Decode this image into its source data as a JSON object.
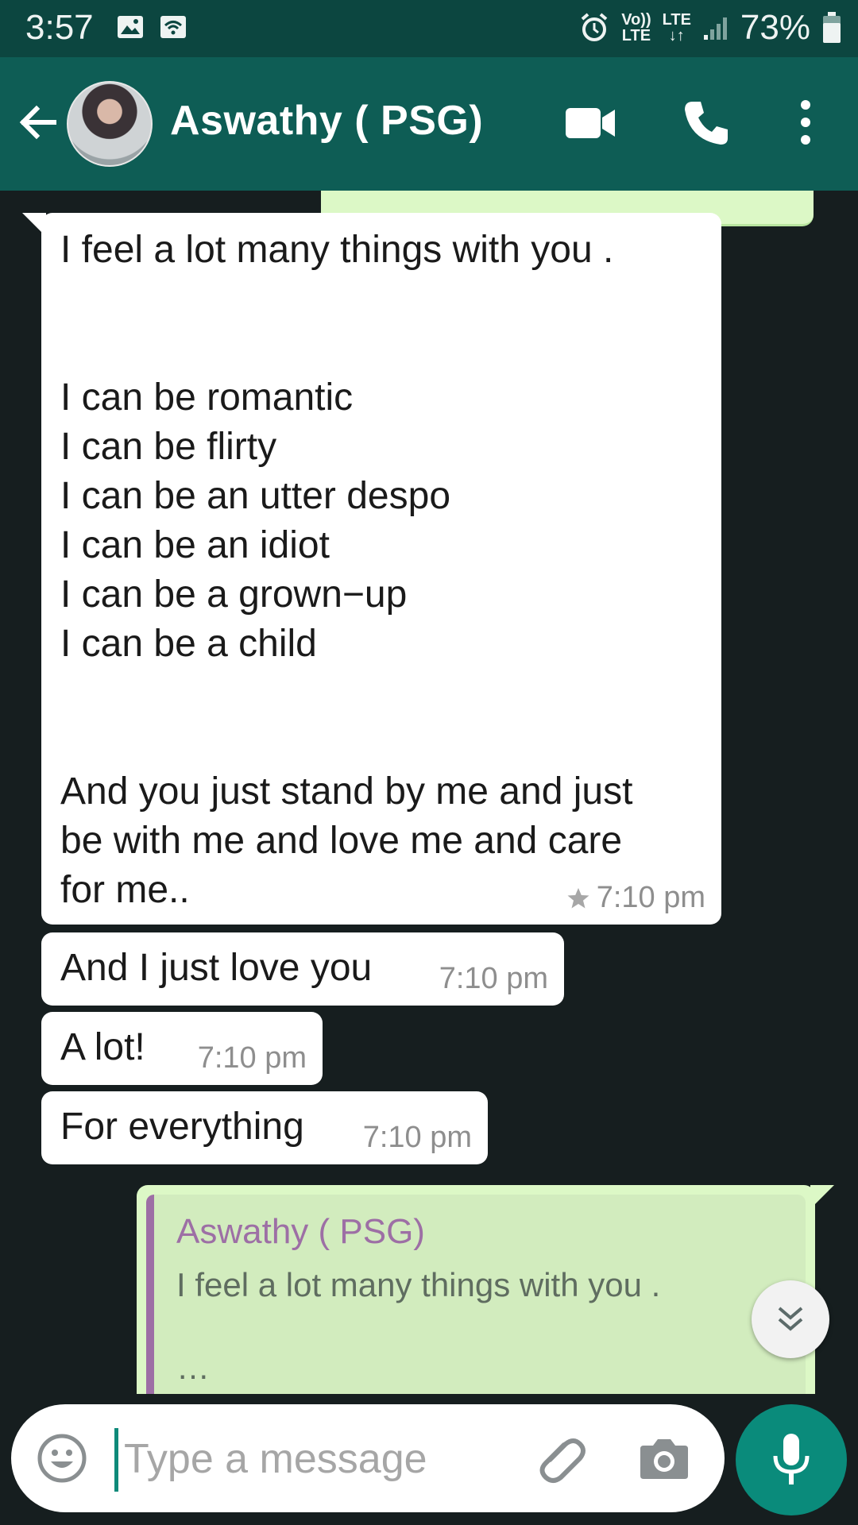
{
  "status_bar": {
    "time": "3:57",
    "volte_label_1": "Vo))",
    "volte_label_2": "LTE",
    "lte_label_1": "LTE",
    "lte_label_2": "↓↑",
    "battery": "73%"
  },
  "header": {
    "contact_name": "Aswathy ( PSG)"
  },
  "messages": [
    {
      "text": "I feel a lot many things with you .\n\n\nI can be romantic\nI can be flirty\nI can be an utter despo\nI can be an idiot\nI can be a grown−up\nI can be a child\n\n\nAnd you just stand by me and just\nbe with me and love me and care\nfor me..",
      "time": "7:10 pm",
      "starred": true
    },
    {
      "text": "And I just love you",
      "time": "7:10 pm"
    },
    {
      "text": "A lot!",
      "time": "7:10 pm"
    },
    {
      "text": "For everything",
      "time": "7:10 pm"
    }
  ],
  "outgoing_reply": {
    "quoted_author": "Aswathy ( PSG)",
    "quoted_text": "I feel a lot many things with you .\n\n…"
  },
  "composer": {
    "placeholder": "Type a message"
  },
  "colors": {
    "status_bar": "#0c4640",
    "header": "#0e5d55",
    "chat_bg": "#161e1f",
    "incoming_bubble": "#ffffff",
    "outgoing_bubble": "#dcf8c6",
    "quote_accent": "#9d6fa5",
    "mic_button": "#0a8b7b"
  },
  "icons": {
    "status_left": [
      "gallery-icon",
      "wifi-icon"
    ],
    "status_right": [
      "alarm-icon",
      "signal-icon",
      "battery-icon"
    ],
    "header": [
      "back-arrow-icon",
      "video-call-icon",
      "phone-icon",
      "more-vert-icon"
    ],
    "composer": [
      "emoji-icon",
      "attach-icon",
      "camera-icon",
      "mic-icon"
    ],
    "scroll": "double-chevron-down-icon",
    "star": "star-icon"
  }
}
